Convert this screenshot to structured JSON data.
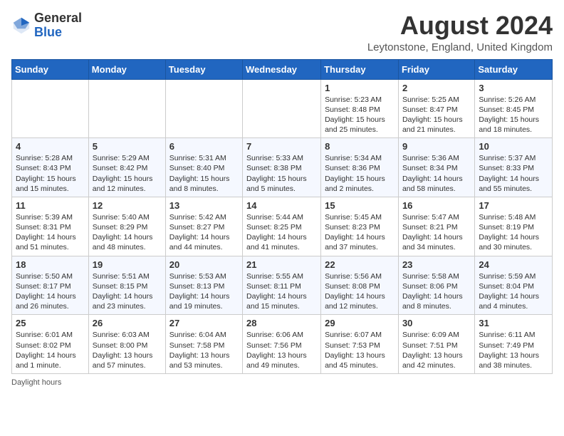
{
  "header": {
    "logo_general": "General",
    "logo_blue": "Blue",
    "month_year": "August 2024",
    "location": "Leytonstone, England, United Kingdom"
  },
  "weekdays": [
    "Sunday",
    "Monday",
    "Tuesday",
    "Wednesday",
    "Thursday",
    "Friday",
    "Saturday"
  ],
  "weeks": [
    [
      {
        "day": "",
        "info": ""
      },
      {
        "day": "",
        "info": ""
      },
      {
        "day": "",
        "info": ""
      },
      {
        "day": "",
        "info": ""
      },
      {
        "day": "1",
        "info": "Sunrise: 5:23 AM\nSunset: 8:48 PM\nDaylight: 15 hours and 25 minutes."
      },
      {
        "day": "2",
        "info": "Sunrise: 5:25 AM\nSunset: 8:47 PM\nDaylight: 15 hours and 21 minutes."
      },
      {
        "day": "3",
        "info": "Sunrise: 5:26 AM\nSunset: 8:45 PM\nDaylight: 15 hours and 18 minutes."
      }
    ],
    [
      {
        "day": "4",
        "info": "Sunrise: 5:28 AM\nSunset: 8:43 PM\nDaylight: 15 hours and 15 minutes."
      },
      {
        "day": "5",
        "info": "Sunrise: 5:29 AM\nSunset: 8:42 PM\nDaylight: 15 hours and 12 minutes."
      },
      {
        "day": "6",
        "info": "Sunrise: 5:31 AM\nSunset: 8:40 PM\nDaylight: 15 hours and 8 minutes."
      },
      {
        "day": "7",
        "info": "Sunrise: 5:33 AM\nSunset: 8:38 PM\nDaylight: 15 hours and 5 minutes."
      },
      {
        "day": "8",
        "info": "Sunrise: 5:34 AM\nSunset: 8:36 PM\nDaylight: 15 hours and 2 minutes."
      },
      {
        "day": "9",
        "info": "Sunrise: 5:36 AM\nSunset: 8:34 PM\nDaylight: 14 hours and 58 minutes."
      },
      {
        "day": "10",
        "info": "Sunrise: 5:37 AM\nSunset: 8:33 PM\nDaylight: 14 hours and 55 minutes."
      }
    ],
    [
      {
        "day": "11",
        "info": "Sunrise: 5:39 AM\nSunset: 8:31 PM\nDaylight: 14 hours and 51 minutes."
      },
      {
        "day": "12",
        "info": "Sunrise: 5:40 AM\nSunset: 8:29 PM\nDaylight: 14 hours and 48 minutes."
      },
      {
        "day": "13",
        "info": "Sunrise: 5:42 AM\nSunset: 8:27 PM\nDaylight: 14 hours and 44 minutes."
      },
      {
        "day": "14",
        "info": "Sunrise: 5:44 AM\nSunset: 8:25 PM\nDaylight: 14 hours and 41 minutes."
      },
      {
        "day": "15",
        "info": "Sunrise: 5:45 AM\nSunset: 8:23 PM\nDaylight: 14 hours and 37 minutes."
      },
      {
        "day": "16",
        "info": "Sunrise: 5:47 AM\nSunset: 8:21 PM\nDaylight: 14 hours and 34 minutes."
      },
      {
        "day": "17",
        "info": "Sunrise: 5:48 AM\nSunset: 8:19 PM\nDaylight: 14 hours and 30 minutes."
      }
    ],
    [
      {
        "day": "18",
        "info": "Sunrise: 5:50 AM\nSunset: 8:17 PM\nDaylight: 14 hours and 26 minutes."
      },
      {
        "day": "19",
        "info": "Sunrise: 5:51 AM\nSunset: 8:15 PM\nDaylight: 14 hours and 23 minutes."
      },
      {
        "day": "20",
        "info": "Sunrise: 5:53 AM\nSunset: 8:13 PM\nDaylight: 14 hours and 19 minutes."
      },
      {
        "day": "21",
        "info": "Sunrise: 5:55 AM\nSunset: 8:11 PM\nDaylight: 14 hours and 15 minutes."
      },
      {
        "day": "22",
        "info": "Sunrise: 5:56 AM\nSunset: 8:08 PM\nDaylight: 14 hours and 12 minutes."
      },
      {
        "day": "23",
        "info": "Sunrise: 5:58 AM\nSunset: 8:06 PM\nDaylight: 14 hours and 8 minutes."
      },
      {
        "day": "24",
        "info": "Sunrise: 5:59 AM\nSunset: 8:04 PM\nDaylight: 14 hours and 4 minutes."
      }
    ],
    [
      {
        "day": "25",
        "info": "Sunrise: 6:01 AM\nSunset: 8:02 PM\nDaylight: 14 hours and 1 minute."
      },
      {
        "day": "26",
        "info": "Sunrise: 6:03 AM\nSunset: 8:00 PM\nDaylight: 13 hours and 57 minutes."
      },
      {
        "day": "27",
        "info": "Sunrise: 6:04 AM\nSunset: 7:58 PM\nDaylight: 13 hours and 53 minutes."
      },
      {
        "day": "28",
        "info": "Sunrise: 6:06 AM\nSunset: 7:56 PM\nDaylight: 13 hours and 49 minutes."
      },
      {
        "day": "29",
        "info": "Sunrise: 6:07 AM\nSunset: 7:53 PM\nDaylight: 13 hours and 45 minutes."
      },
      {
        "day": "30",
        "info": "Sunrise: 6:09 AM\nSunset: 7:51 PM\nDaylight: 13 hours and 42 minutes."
      },
      {
        "day": "31",
        "info": "Sunrise: 6:11 AM\nSunset: 7:49 PM\nDaylight: 13 hours and 38 minutes."
      }
    ]
  ],
  "footer": "Daylight hours"
}
